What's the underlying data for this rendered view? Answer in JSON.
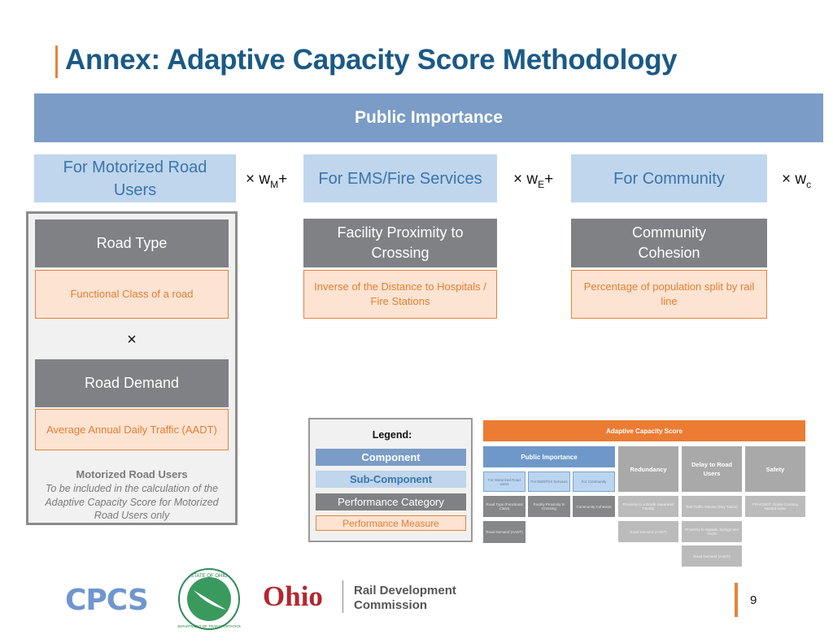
{
  "title": "Annex: Adaptive Capacity Score Methodology",
  "component": "Public Importance",
  "sub_components": [
    {
      "label": "For Motorized Road Users",
      "weight": {
        "prefix": "× w",
        "sub": "M",
        "suffix": "+"
      }
    },
    {
      "label": "For EMS/Fire Services",
      "weight": {
        "prefix": "× w",
        "sub": "E",
        "suffix": "+"
      }
    },
    {
      "label": "For Community",
      "weight": {
        "prefix": "× w",
        "sub": "c",
        "suffix": ""
      }
    }
  ],
  "motorized": {
    "category1": "Road Type",
    "measure1": "Functional Class of a road",
    "operator": "×",
    "category2": "Road Demand",
    "measure2": "Average Annual Daily Traffic (AADT)",
    "note_title": "Motorized Road Users",
    "note_body": "To be included in the calculation of the Adaptive Capacity Score for Motorized Road Users only"
  },
  "ems": {
    "category": "Facility Proximity to Crossing",
    "measure": "Inverse of the Distance to Hospitals / Fire Stations"
  },
  "community": {
    "category": "Community Cohesion",
    "measure": "Percentage of population split by rail line"
  },
  "legend": {
    "title": "Legend:",
    "component": "Component",
    "sub_component": "Sub-Component",
    "performance_category": "Performance Category",
    "performance_measure": "Performance Measure"
  },
  "mini_diagram": {
    "score": "Adaptive Capacity Score",
    "public_importance": "Public Importance",
    "subs": [
      "For Motorized Road users",
      "For EMS/Fire Services",
      "For Community"
    ],
    "pi_categories": [
      "Road Type (Functional Class)",
      "Facility Proximity to Crossing",
      "Community Cohesion"
    ],
    "pi_extra": "Road Demand (AADT)",
    "components": [
      "Redundancy",
      "Delay to Road Users",
      "Safety"
    ],
    "redundancy_measures": [
      "Proximity to a Grade Separated Facility",
      "Road Demand (AADT)"
    ],
    "delay_measures": [
      "Rail Traffic Volume (Day Trains)",
      "Proximity to Signals, Sidings and Yards",
      "Road Demand (AADT)"
    ],
    "safety_measures": [
      "FRA/ODOT Grade Crossing Hazard Index"
    ]
  },
  "logos": {
    "cpcs": "CPCS",
    "odot_ring_top": "STATE OF OHIO",
    "odot_ring_bottom": "DEPARTMENT OF TRANSPORTATION",
    "ohio": "Ohio",
    "rail_line1": "Rail Development",
    "rail_line2": "Commission"
  },
  "page_number": "9",
  "colors": {
    "accent": "#e8823a",
    "title": "#1a5a85",
    "component": "#7a9cc6",
    "sub_component": "#bfd6ec",
    "category": "#7f8184",
    "measure_fill": "#fde3d2"
  }
}
